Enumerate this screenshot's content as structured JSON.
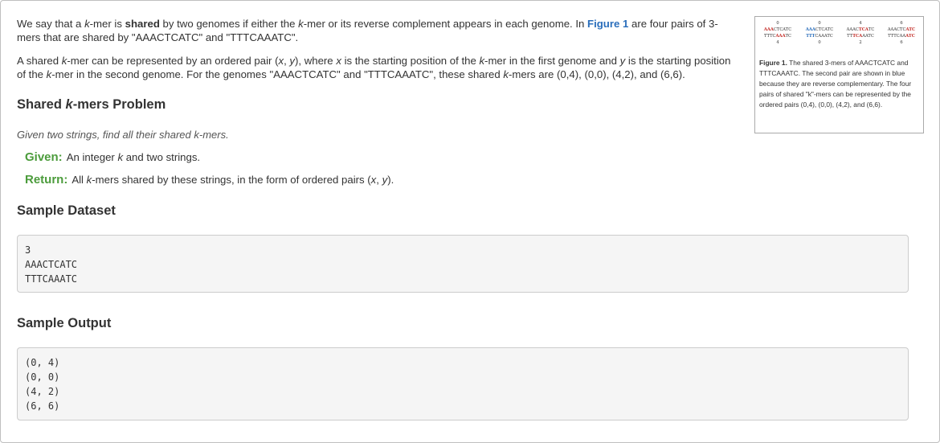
{
  "intro": {
    "p1_a": "We say that a ",
    "k": "k",
    "p1_b": "-mer is ",
    "shared_word": "shared",
    "p1_c": " by two genomes if either the ",
    "p1_d": "-mer or its reverse complement appears in each genome. In ",
    "figure_link": "Figure 1",
    "p1_e": " are four pairs of 3-mers that are shared by \"AAACTCATC\" and \"TTTCAAATC\".",
    "p2_a": "A shared ",
    "p2_b": "-mer can be represented by an ordered pair (",
    "x": "x",
    "comma": ", ",
    "y": "y",
    "p2_c": "), where ",
    "p2_d": " is the starting position of the ",
    "p2_e": "-mer in the first genome and ",
    "p2_f": " is the starting position of the ",
    "p2_g": "-mer in the second genome. For the genomes \"AAACTCATC\" and \"TTTCAAATC\", these shared ",
    "p2_h": "-mers are (0,4), (0,0), (4,2), and (6,6)."
  },
  "problem": {
    "title_a": "Shared ",
    "title_k": "k",
    "title_b": "-mers Problem",
    "statement": "Given two strings, find all their shared k-mers.",
    "given_label": "Given:",
    "given_text_a": "An integer ",
    "given_text_b": " and two strings.",
    "return_label": "Return:",
    "return_text_a": "All ",
    "return_text_b": "-mers shared by these strings, in the form of ordered pairs (",
    "return_text_c": ")."
  },
  "sample_dataset": {
    "title": "Sample Dataset",
    "lines": [
      "3",
      "AAACTCATC",
      "TTTCAAATC"
    ]
  },
  "sample_output": {
    "title": "Sample Output",
    "lines": [
      "(0, 4)",
      "(0, 0)",
      "(4, 2)",
      "(6, 6)"
    ]
  },
  "figure": {
    "caption_label": "Figure 1.",
    "caption_text": " The shared 3-mers of AAACTCATC and TTTCAAATC. The second pair are shown in blue because they are reverse complementary. The four pairs of shared \"k\"-mers can be represented by the ordered pairs (0,4), (0,0), (4,2), and (6,6).",
    "pairs": [
      {
        "top_num": "0",
        "top_pre": "",
        "top_hl": "AAA",
        "top_post": "CTCATC",
        "bot_pre": "TTTC",
        "bot_hl": "AAA",
        "bot_post": "TC",
        "bot_num": "4",
        "color": "red"
      },
      {
        "top_num": "0",
        "top_pre": "",
        "top_hl": "AAA",
        "top_post": "CTCATC",
        "bot_pre": "",
        "bot_hl": "TTT",
        "bot_post": "CAAATC",
        "bot_num": "0",
        "color": "blue"
      },
      {
        "top_num": "4",
        "top_pre": "AAAC",
        "top_hl": "TCA",
        "top_post": "TC",
        "bot_pre": "TT",
        "bot_hl": "TCA",
        "bot_post": "AATC",
        "bot_num": "2",
        "color": "red"
      },
      {
        "top_num": "6",
        "top_pre": "AAACTC",
        "top_hl": "ATC",
        "top_post": "",
        "bot_pre": "TTTCAA",
        "bot_hl": "ATC",
        "bot_post": "",
        "bot_num": "6",
        "color": "red"
      }
    ]
  }
}
